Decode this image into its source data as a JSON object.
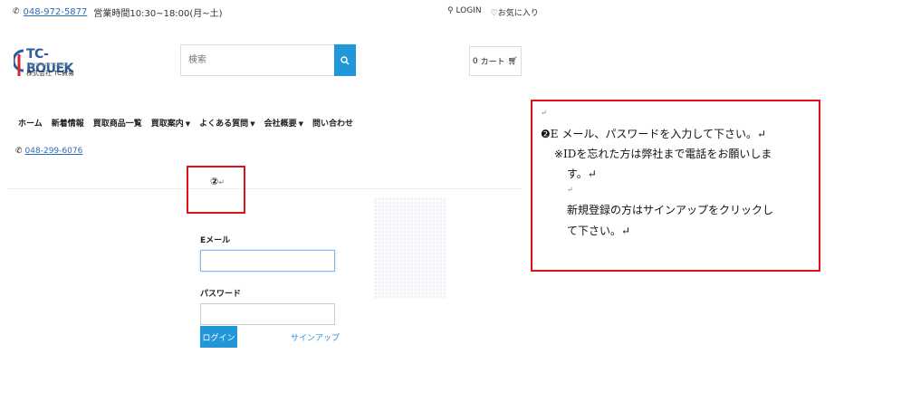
{
  "header": {
    "phone": "048-972-5877",
    "hours": "営業時間10:30~18:00(月~土)",
    "login": "LOGIN",
    "favorites": "お気に入り"
  },
  "logo": {
    "name": "TC-BOUEK",
    "tagline": "TRUST&EFFICIENT",
    "company": "株式会社 TC貿易"
  },
  "search": {
    "placeholder": "検索"
  },
  "cart": {
    "count": "0",
    "label": "カート"
  },
  "nav": {
    "items": [
      "ホーム",
      "新着情報",
      "買取商品一覧",
      "買取案内",
      "よくある質問",
      "会社概要",
      "問い合わせ"
    ]
  },
  "phone2": "048-299-6076",
  "annotation_small": {
    "marker": "②",
    "return_mark": "↵"
  },
  "form": {
    "email_label": "Eメール",
    "password_label": "パスワード",
    "login_button": "ログイン",
    "signup_link": "サインアップ"
  },
  "annotation_big": {
    "line0": "↵",
    "line1": "❷E メール、パスワードを入力して下さい。↵",
    "line2": "※IDを忘れた方は弊社まで電話をお願いしま",
    "line3": "す。↵",
    "line4": "↵",
    "line5": "新規登録の方はサインアップをクリックし",
    "line6": "て下さい。↵"
  },
  "colors": {
    "accent": "#2196d9",
    "annotation": "#e0101a",
    "link": "#2a6ebb"
  }
}
